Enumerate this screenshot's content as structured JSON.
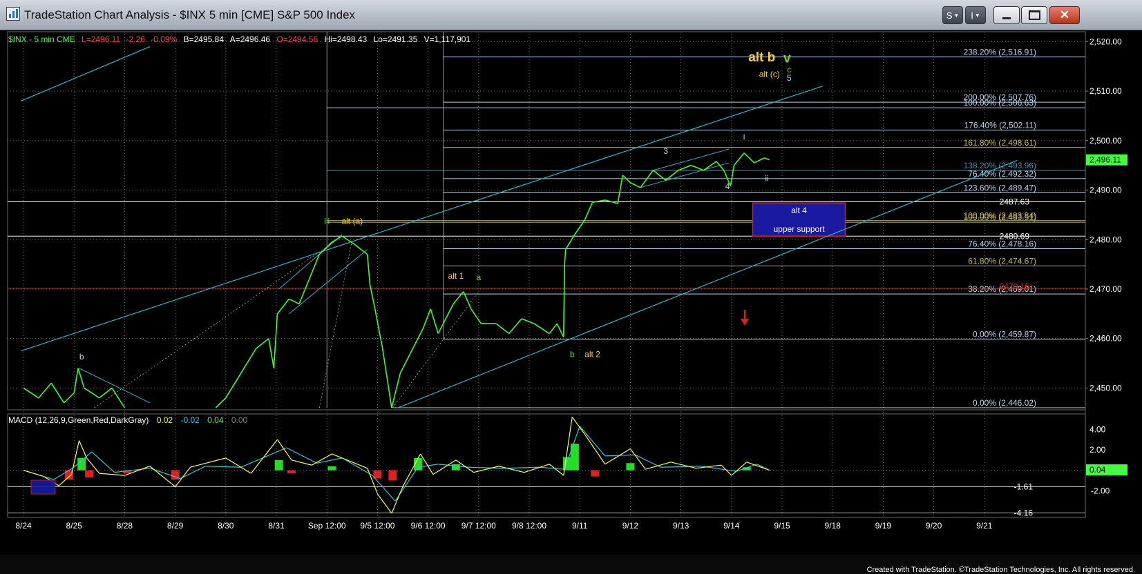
{
  "window": {
    "title": "TradeStation Chart Analysis  - $INX 5 min [CME] S&P 500 Index",
    "buttons": [
      "S",
      "I"
    ]
  },
  "header": {
    "symbol": "$INX - 5 min  CME",
    "last": "L=2496.11",
    "change": "-2.26",
    "pct": "-0.09%",
    "bid": "B=2495.84",
    "ask": "A=2496.46",
    "open": "O=2494.56",
    "high": "Hi=2498.43",
    "low": "Lo=2491.35",
    "volume": "V=1,117,901"
  },
  "footer": "Created with TradeStation. ©TradeStation Technologies, Inc. All rights reserved.",
  "chart_data": {
    "type": "line",
    "price_axis": {
      "ticks": [
        "2,520.00",
        "2,510.00",
        "2,500.00",
        "2,490.00",
        "2,480.00",
        "2,470.00",
        "2,460.00",
        "2,450.00"
      ],
      "tick_values": [
        2520,
        2510,
        2500,
        2490,
        2480,
        2470,
        2460,
        2450
      ],
      "ylim": [
        2445.6,
        2522
      ],
      "last_price": "2,496.11",
      "last_value": 2496.11
    },
    "time_axis": {
      "labels": [
        "8/24",
        "8/25",
        "8/28",
        "8/29",
        "8/30",
        "8/31",
        "Sep 12:00",
        "9/5 12:00",
        "9/6 12:00",
        "9/7 12:00",
        "9/8 12:00",
        "9/11",
        "9/12",
        "9/13",
        "9/14",
        "9/15",
        "9/18",
        "9/19",
        "9/20",
        "9/21"
      ],
      "positions": [
        0,
        1,
        2,
        3,
        4,
        5,
        6,
        7,
        8,
        9,
        10,
        11,
        12,
        13,
        14,
        15,
        16,
        17,
        18,
        19
      ]
    },
    "price_series": [
      {
        "x": 0,
        "y": 2450
      },
      {
        "x": 0.3,
        "y": 2448
      },
      {
        "x": 0.55,
        "y": 2451
      },
      {
        "x": 0.8,
        "y": 2447
      },
      {
        "x": 1.0,
        "y": 2449
      },
      {
        "x": 1.08,
        "y": 2454
      },
      {
        "x": 1.2,
        "y": 2450
      },
      {
        "x": 1.5,
        "y": 2448
      },
      {
        "x": 1.75,
        "y": 2450
      },
      {
        "x": 2.0,
        "y": 2446
      },
      {
        "x": 3.8,
        "y": 2446
      },
      {
        "x": 4.0,
        "y": 2448
      },
      {
        "x": 4.3,
        "y": 2453
      },
      {
        "x": 4.6,
        "y": 2458
      },
      {
        "x": 4.85,
        "y": 2460
      },
      {
        "x": 4.95,
        "y": 2454
      },
      {
        "x": 5.02,
        "y": 2465
      },
      {
        "x": 5.25,
        "y": 2468
      },
      {
        "x": 5.45,
        "y": 2467
      },
      {
        "x": 5.65,
        "y": 2472
      },
      {
        "x": 5.85,
        "y": 2477
      },
      {
        "x": 6.1,
        "y": 2479.5
      },
      {
        "x": 6.3,
        "y": 2480.7
      },
      {
        "x": 6.55,
        "y": 2479
      },
      {
        "x": 6.8,
        "y": 2477
      },
      {
        "x": 6.85,
        "y": 2471
      },
      {
        "x": 6.95,
        "y": 2466
      },
      {
        "x": 7.1,
        "y": 2458
      },
      {
        "x": 7.28,
        "y": 2446
      },
      {
        "x": 7.45,
        "y": 2453
      },
      {
        "x": 7.65,
        "y": 2457
      },
      {
        "x": 7.9,
        "y": 2462
      },
      {
        "x": 8.05,
        "y": 2466
      },
      {
        "x": 8.2,
        "y": 2461
      },
      {
        "x": 8.5,
        "y": 2467
      },
      {
        "x": 8.7,
        "y": 2469.5
      },
      {
        "x": 8.85,
        "y": 2466
      },
      {
        "x": 9.05,
        "y": 2463
      },
      {
        "x": 9.35,
        "y": 2463
      },
      {
        "x": 9.6,
        "y": 2461
      },
      {
        "x": 9.85,
        "y": 2464
      },
      {
        "x": 10.1,
        "y": 2463
      },
      {
        "x": 10.4,
        "y": 2461
      },
      {
        "x": 10.55,
        "y": 2463
      },
      {
        "x": 10.68,
        "y": 2460.3
      },
      {
        "x": 10.7,
        "y": 2475
      },
      {
        "x": 10.72,
        "y": 2478
      },
      {
        "x": 10.9,
        "y": 2481
      },
      {
        "x": 11.1,
        "y": 2484
      },
      {
        "x": 11.25,
        "y": 2487.5
      },
      {
        "x": 11.5,
        "y": 2488
      },
      {
        "x": 11.75,
        "y": 2487.3
      },
      {
        "x": 11.85,
        "y": 2493
      },
      {
        "x": 12.0,
        "y": 2491.5
      },
      {
        "x": 12.2,
        "y": 2490.5
      },
      {
        "x": 12.45,
        "y": 2494
      },
      {
        "x": 12.7,
        "y": 2492
      },
      {
        "x": 12.95,
        "y": 2494
      },
      {
        "x": 13.2,
        "y": 2495
      },
      {
        "x": 13.45,
        "y": 2494
      },
      {
        "x": 13.7,
        "y": 2495.8
      },
      {
        "x": 13.85,
        "y": 2494
      },
      {
        "x": 13.98,
        "y": 2490.8
      },
      {
        "x": 14.05,
        "y": 2495
      },
      {
        "x": 14.25,
        "y": 2497.5
      },
      {
        "x": 14.45,
        "y": 2495.5
      },
      {
        "x": 14.65,
        "y": 2496.5
      },
      {
        "x": 14.75,
        "y": 2496.11
      }
    ],
    "fib_levels": [
      {
        "label": "238.20% (2,516.91)",
        "value": 2516.91,
        "color": "#b8d4ec"
      },
      {
        "label": "200.00% (2,507.76)",
        "value": 2507.76,
        "color": "#b8d4ec"
      },
      {
        "label": "100.00% (2,506.63)",
        "value": 2506.63,
        "color": "#b8d4ec"
      },
      {
        "label": "176.40% (2,502.11)",
        "value": 2502.11,
        "color": "#b8d4ec"
      },
      {
        "label": "161.80% (2,498.61)",
        "value": 2498.61,
        "color": "#c8b85a"
      },
      {
        "label": "138.20% (2,493.96)",
        "value": 2493.96,
        "color": "#4a8aa8"
      },
      {
        "label": "76.40% (2,492.32)",
        "value": 2492.32,
        "color": "#b8d4ec"
      },
      {
        "label": "123.60% (2,489.47)",
        "value": 2489.47,
        "color": "#b8d4ec"
      },
      {
        "label": "100.00% (2,483.84)",
        "value": 2483.84,
        "color": "#c8b85a"
      },
      {
        "label": "100.00% (2,483.51)",
        "value": 2483.51,
        "color": "#c8b85a"
      },
      {
        "label": "76.40% (2,478.16)",
        "value": 2478.16,
        "color": "#b8d4ec"
      },
      {
        "label": "61.80% (2,474.67)",
        "value": 2474.67,
        "color": "#c8b85a"
      },
      {
        "label": "38.20% (2,469.01)",
        "value": 2469.01,
        "color": "#b8d4ec"
      },
      {
        "label": "0.00% (2,459.87)",
        "value": 2459.87,
        "color": "#b8d4ec"
      },
      {
        "label": "0.00% (2,446.02)",
        "value": 2446.02,
        "color": "#b8d4ec"
      }
    ],
    "horizontal_levels": [
      {
        "label": "2487.63",
        "value": 2487.63,
        "color": "#ffffff"
      },
      {
        "label": "2480.69",
        "value": 2480.69,
        "color": "#ffffff"
      },
      {
        "label": "2470.16",
        "value": 2470.16,
        "color": "#e02020"
      }
    ],
    "support_box": {
      "title": "alt 4",
      "subtitle": "upper support",
      "x_range": [
        14.42,
        16.25
      ],
      "y_range": [
        2480.7,
        2487.4
      ]
    },
    "wave_labels": [
      {
        "text": "alt b",
        "x": 14.6,
        "y": 2516,
        "color": "#ffd21e",
        "big": true
      },
      {
        "text": "v",
        "x": 15.1,
        "y": 2515.8,
        "color": "#7fd520",
        "big": true
      },
      {
        "text": "c",
        "x": 15.14,
        "y": 2513.8,
        "color": "#7fd520"
      },
      {
        "text": "alt (c)",
        "x": 14.75,
        "y": 2512.9,
        "color": "#ffd21e"
      },
      {
        "text": "5",
        "x": 15.14,
        "y": 2512.1,
        "color": "#b8d4ec"
      },
      {
        "text": "i",
        "x": 14.25,
        "y": 2500.2,
        "color": "#b8d4ec"
      },
      {
        "text": "3",
        "x": 12.7,
        "y": 2497.3,
        "color": "#b8d4ec"
      },
      {
        "text": "4",
        "x": 13.92,
        "y": 2490.2,
        "color": "#b8d4ec"
      },
      {
        "text": "ii",
        "x": 14.7,
        "y": 2491.8,
        "color": "#b8d4ec"
      },
      {
        "text": "iii",
        "x": 6.0,
        "y": 2483.2,
        "color": "#7fd520"
      },
      {
        "text": "alt (a)",
        "x": 6.5,
        "y": 2483.2,
        "color": "#ffd21e"
      },
      {
        "text": "alt 1",
        "x": 8.55,
        "y": 2472.1,
        "color": "#ffd21e"
      },
      {
        "text": "a",
        "x": 9.0,
        "y": 2471.8,
        "color": "#7fd520"
      },
      {
        "text": "b",
        "x": 1.15,
        "y": 2455.8,
        "color": "#b8d4ec"
      },
      {
        "text": "b",
        "x": 10.85,
        "y": 2456.3,
        "color": "#7fd520"
      },
      {
        "text": "alt 2",
        "x": 11.25,
        "y": 2456.3,
        "color": "#ffd21e"
      }
    ],
    "trend_lines": [
      {
        "points": [
          [
            -0.05,
            2508
          ],
          [
            2.5,
            2519
          ]
        ],
        "color": "#30b4c8"
      },
      {
        "points": [
          [
            -0.05,
            2457.5
          ],
          [
            15.8,
            2511
          ]
        ],
        "color": "#30b4c8"
      },
      {
        "points": [
          [
            7.4,
            2446
          ],
          [
            19.65,
            2496
          ]
        ],
        "color": "#30b4c8"
      }
    ],
    "macd": {
      "legend": "MACD (12,26,9,Green,Red,DarkGray)",
      "values": [
        "0.02",
        "-0.02",
        "0.04",
        "0.00"
      ],
      "value_colors": [
        "#ffff40",
        "#30c8d8",
        "#40ff40",
        "#808080"
      ],
      "ticks": [
        "4.00",
        "2.00"
      ],
      "tick_values": [
        4,
        2
      ],
      "levels": [
        {
          "label": "-1.61",
          "value": -1.61
        },
        {
          "label": "-2.00",
          "value": -2
        },
        {
          "label": "-4.16",
          "value": -4.16
        }
      ],
      "current": "0.04",
      "ylim": [
        -4.6,
        5.5
      ],
      "macd_line": [
        {
          "x": 0,
          "y": 0
        },
        {
          "x": 0.4,
          "y": -0.6
        },
        {
          "x": 0.7,
          "y": -1.5
        },
        {
          "x": 0.95,
          "y": -0.4
        },
        {
          "x": 1.1,
          "y": 2.9
        },
        {
          "x": 1.25,
          "y": 1.2
        },
        {
          "x": 1.5,
          "y": -0.3
        },
        {
          "x": 2.0,
          "y": -0.5
        },
        {
          "x": 2.5,
          "y": 0.4
        },
        {
          "x": 3.0,
          "y": -1.6
        },
        {
          "x": 3.3,
          "y": 0.3
        },
        {
          "x": 4.0,
          "y": 1.2
        },
        {
          "x": 4.5,
          "y": -0.3
        },
        {
          "x": 5.02,
          "y": 3.0
        },
        {
          "x": 5.3,
          "y": 1.0
        },
        {
          "x": 5.7,
          "y": 0.5
        },
        {
          "x": 6.1,
          "y": 1.6
        },
        {
          "x": 6.5,
          "y": 0.8
        },
        {
          "x": 6.8,
          "y": 0.2
        },
        {
          "x": 7.0,
          "y": -2.3
        },
        {
          "x": 7.28,
          "y": -4.2
        },
        {
          "x": 7.5,
          "y": -1.6
        },
        {
          "x": 7.85,
          "y": 1.6
        },
        {
          "x": 8.1,
          "y": -0.4
        },
        {
          "x": 8.55,
          "y": 1.0
        },
        {
          "x": 8.9,
          "y": -0.2
        },
        {
          "x": 9.4,
          "y": 0.4
        },
        {
          "x": 9.9,
          "y": -0.2
        },
        {
          "x": 10.4,
          "y": 0.6
        },
        {
          "x": 10.68,
          "y": -0.5
        },
        {
          "x": 10.85,
          "y": 5.2
        },
        {
          "x": 11.1,
          "y": 3.5
        },
        {
          "x": 11.5,
          "y": 0.6
        },
        {
          "x": 12.0,
          "y": 2.1
        },
        {
          "x": 12.3,
          "y": 0.1
        },
        {
          "x": 12.8,
          "y": 0.8
        },
        {
          "x": 13.3,
          "y": 0.2
        },
        {
          "x": 13.8,
          "y": 0.5
        },
        {
          "x": 14.0,
          "y": -0.5
        },
        {
          "x": 14.3,
          "y": 0.8
        },
        {
          "x": 14.75,
          "y": 0.02
        }
      ],
      "signal_line": [
        {
          "x": 0,
          "y": 0
        },
        {
          "x": 0.6,
          "y": -0.9
        },
        {
          "x": 1.0,
          "y": 0.3
        },
        {
          "x": 1.35,
          "y": 1.8
        },
        {
          "x": 1.8,
          "y": -0.2
        },
        {
          "x": 2.5,
          "y": 0.2
        },
        {
          "x": 3.1,
          "y": -0.8
        },
        {
          "x": 3.6,
          "y": 0.4
        },
        {
          "x": 4.3,
          "y": 0.3
        },
        {
          "x": 5.2,
          "y": 2.2
        },
        {
          "x": 5.8,
          "y": 0.7
        },
        {
          "x": 6.3,
          "y": 1.2
        },
        {
          "x": 6.9,
          "y": -0.5
        },
        {
          "x": 7.35,
          "y": -3.0
        },
        {
          "x": 7.8,
          "y": 0.3
        },
        {
          "x": 8.2,
          "y": 0.6
        },
        {
          "x": 8.8,
          "y": 0.3
        },
        {
          "x": 9.5,
          "y": 0.2
        },
        {
          "x": 10.2,
          "y": 0.3
        },
        {
          "x": 10.7,
          "y": 0.1
        },
        {
          "x": 11.0,
          "y": 4.3
        },
        {
          "x": 11.5,
          "y": 1.4
        },
        {
          "x": 12.1,
          "y": 1.5
        },
        {
          "x": 12.6,
          "y": 0.3
        },
        {
          "x": 13.4,
          "y": 0.4
        },
        {
          "x": 14.1,
          "y": -0.1
        },
        {
          "x": 14.5,
          "y": 0.6
        },
        {
          "x": 14.75,
          "y": 0.0
        }
      ],
      "histogram": [
        {
          "x": 0.9,
          "y": -0.9
        },
        {
          "x": 1.15,
          "y": 1.2
        },
        {
          "x": 1.3,
          "y": -0.7
        },
        {
          "x": 2.05,
          "y": -0.3
        },
        {
          "x": 3.0,
          "y": -0.9
        },
        {
          "x": 5.05,
          "y": 1.0
        },
        {
          "x": 5.3,
          "y": -0.3
        },
        {
          "x": 6.1,
          "y": 0.4
        },
        {
          "x": 7.0,
          "y": -0.8
        },
        {
          "x": 7.3,
          "y": -1.0
        },
        {
          "x": 7.8,
          "y": 1.2
        },
        {
          "x": 8.55,
          "y": 0.6
        },
        {
          "x": 10.75,
          "y": 1.3
        },
        {
          "x": 10.9,
          "y": 2.6
        },
        {
          "x": 11.3,
          "y": -0.6
        },
        {
          "x": 12.0,
          "y": 0.7
        },
        {
          "x": 14.3,
          "y": 0.3
        }
      ]
    }
  }
}
